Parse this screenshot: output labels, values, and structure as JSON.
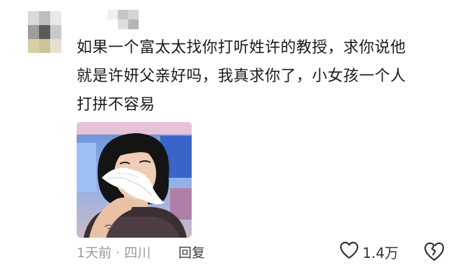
{
  "comment": {
    "text": "如果一个富太太找你打听姓许的教授，求你说他\n就是许妍父亲好吗，我真求你了，小女孩一个人\n打拼不容易",
    "sticker": "crying-woman-tissue-image"
  },
  "footer": {
    "time_location": "1天前 · 四川",
    "reply_label": "回复",
    "like_count": "1.4万"
  },
  "icons": {
    "like": "heart-outline-icon",
    "dislike": "broken-heart-icon"
  }
}
